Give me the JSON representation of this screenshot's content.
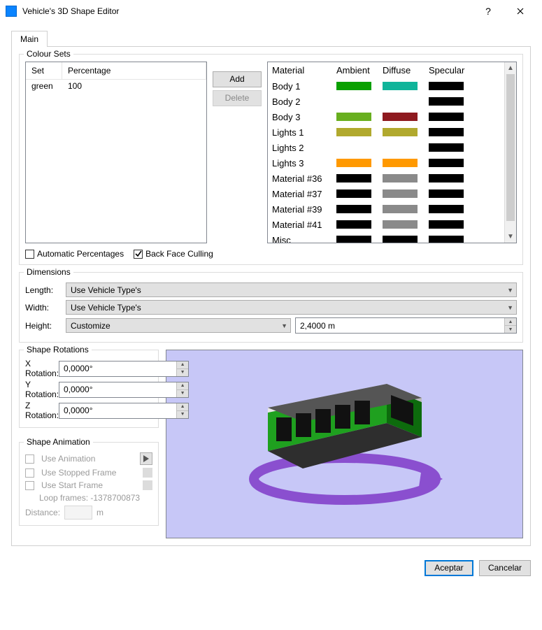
{
  "window": {
    "title": "Vehicle's 3D Shape Editor"
  },
  "tabs": {
    "main": "Main"
  },
  "colourSets": {
    "legend": "Colour Sets",
    "headers": {
      "set": "Set",
      "percentage": "Percentage"
    },
    "rows": [
      {
        "set": "green",
        "percentage": "100"
      }
    ],
    "addBtn": "Add",
    "deleteBtn": "Delete",
    "autoPercentages": {
      "label": "Automatic Percentages",
      "checked": false
    },
    "backFaceCulling": {
      "label": "Back Face Culling",
      "checked": true
    },
    "materialHeaders": {
      "material": "Material",
      "ambient": "Ambient",
      "diffuse": "Diffuse",
      "specular": "Specular"
    },
    "materials": [
      {
        "name": "Body 1",
        "ambient": "#0aa000",
        "diffuse": "#10b49a",
        "specular": "#000000"
      },
      {
        "name": "Body 2",
        "ambient": null,
        "diffuse": null,
        "specular": "#000000"
      },
      {
        "name": "Body 3",
        "ambient": "#68af1f",
        "diffuse": "#8e1a1f",
        "specular": "#000000"
      },
      {
        "name": "Lights 1",
        "ambient": "#b1a92e",
        "diffuse": "#b1a92e",
        "specular": "#000000"
      },
      {
        "name": "Lights 2",
        "ambient": null,
        "diffuse": null,
        "specular": "#000000"
      },
      {
        "name": "Lights 3",
        "ambient": "#ff9900",
        "diffuse": "#ff9900",
        "specular": "#000000"
      },
      {
        "name": "Material #36",
        "ambient": "#000000",
        "diffuse": "#8a8a8a",
        "specular": "#000000"
      },
      {
        "name": "Material #37",
        "ambient": "#000000",
        "diffuse": "#8a8a8a",
        "specular": "#000000"
      },
      {
        "name": "Material #39",
        "ambient": "#000000",
        "diffuse": "#8a8a8a",
        "specular": "#000000"
      },
      {
        "name": "Material #41",
        "ambient": "#000000",
        "diffuse": "#8a8a8a",
        "specular": "#000000"
      },
      {
        "name": "Misc",
        "ambient": "#000000",
        "diffuse": "#000000",
        "specular": "#000000"
      }
    ]
  },
  "dimensions": {
    "legend": "Dimensions",
    "lengthLabel": "Length:",
    "widthLabel": "Width:",
    "heightLabel": "Height:",
    "lengthValue": "Use Vehicle Type's",
    "widthValue": "Use Vehicle Type's",
    "heightMode": "Customize",
    "heightValue": "2,4000 m"
  },
  "rotations": {
    "legend": "Shape Rotations",
    "xLabel": "X Rotation:",
    "xValue": "0,0000°",
    "yLabel": "Y Rotation:",
    "yValue": "0,0000°",
    "zLabel": "Z Rotation:",
    "zValue": "0,0000°"
  },
  "animation": {
    "legend": "Shape Animation",
    "useAnimation": "Use Animation",
    "useStoppedFrame": "Use Stopped Frame",
    "useStartFrame": "Use Start Frame",
    "loopFrames": "Loop frames: -1378700873",
    "distanceLabel": "Distance:",
    "distanceUnit": "m"
  },
  "footer": {
    "accept": "Aceptar",
    "cancel": "Cancelar"
  }
}
